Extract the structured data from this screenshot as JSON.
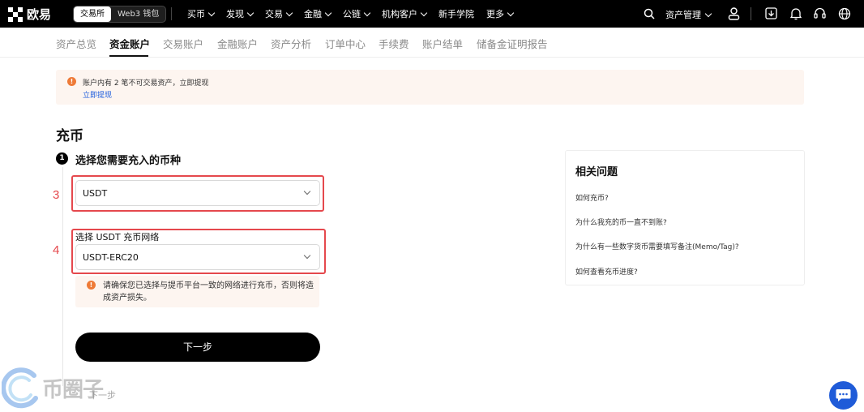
{
  "brand": {
    "name": "欧易"
  },
  "topnav": {
    "toggle": {
      "exchange": "交易所",
      "web3": "Web3 钱包"
    },
    "menu": [
      {
        "label": "买币"
      },
      {
        "label": "发现"
      },
      {
        "label": "交易"
      },
      {
        "label": "金融"
      },
      {
        "label": "公链"
      },
      {
        "label": "机构客户"
      },
      {
        "label": "新手学院"
      },
      {
        "label": "更多"
      }
    ],
    "asset_management": "资产管理"
  },
  "subnav": {
    "items": [
      "资产总览",
      "资金账户",
      "交易账户",
      "金融账户",
      "资产分析",
      "订单中心",
      "手续费",
      "账户结单",
      "储备金证明报告"
    ],
    "active": "资金账户"
  },
  "notice": {
    "text": "账户内有 2 笔不可交易资产，立即提现",
    "link": "立即提现"
  },
  "page_title": "充币",
  "step": {
    "number": "1",
    "title": "选择您需要充入的币种",
    "coin_value": "USDT",
    "network_label": "选择 USDT 充币网络",
    "network_value": "USDT-ERC20",
    "warning": "请确保您已选择与提币平台一致的网络进行充币，否则将造成资产损失。",
    "next_button": "下一步"
  },
  "annotations": {
    "coin": "3",
    "network": "4"
  },
  "faq": {
    "title": "相关问题",
    "items": [
      "如何充币?",
      "为什么我充的币一直不到账?",
      "为什么有一些数字货币需要填写备注(Memo/Tag)?",
      "如何查看充币进度?"
    ]
  },
  "watermark": {
    "text": "币圈子",
    "sub": "下一步"
  },
  "colors": {
    "accent_red": "#e5484d",
    "warning_orange": "#ee7a37",
    "link_blue": "#1b5bdc",
    "chat_blue": "#1f5bd8"
  }
}
